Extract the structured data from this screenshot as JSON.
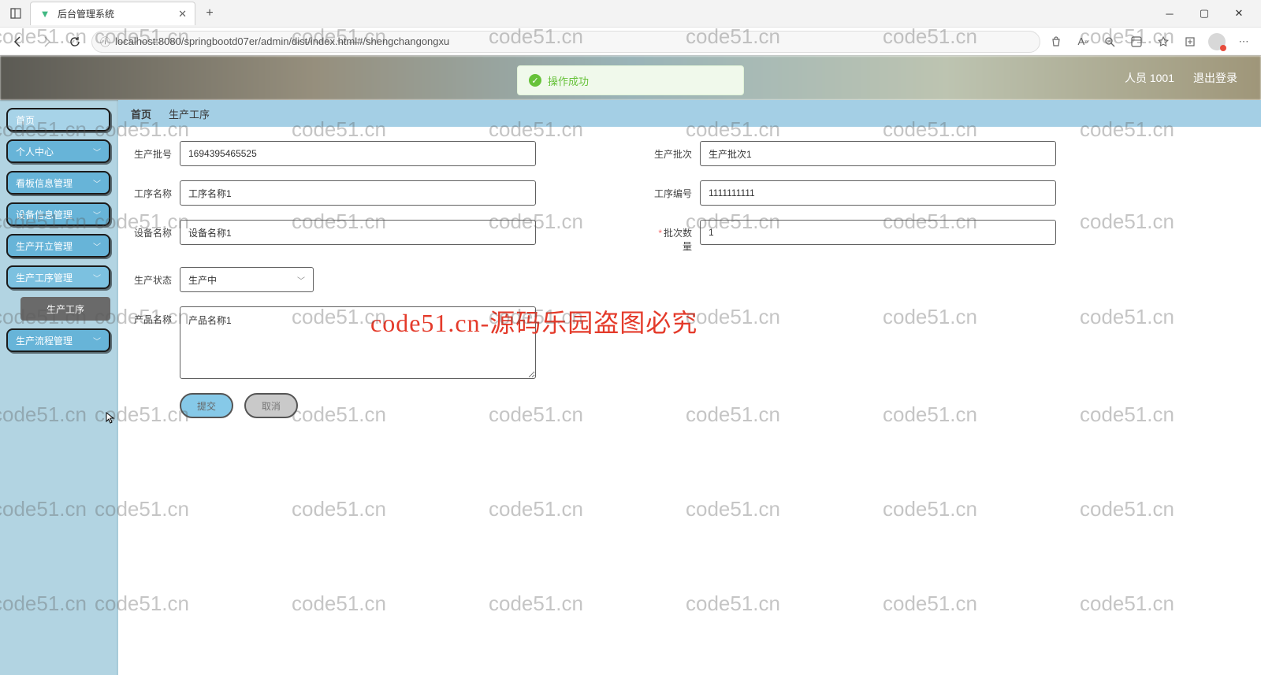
{
  "browser": {
    "tab_title": "后台管理系统",
    "url": "localhost:8080/springbootd07er/admin/dist/index.html#/shengchangongxu"
  },
  "toast": {
    "text": "操作成功"
  },
  "header": {
    "user": "人员 1001",
    "logout": "退出登录"
  },
  "sidebar": {
    "items": [
      {
        "label": "首页"
      },
      {
        "label": "个人中心"
      },
      {
        "label": "看板信息管理"
      },
      {
        "label": "设备信息管理"
      },
      {
        "label": "生产开立管理"
      },
      {
        "label": "生产工序管理"
      },
      {
        "label": "生产流程管理"
      }
    ],
    "sub_item": "生产工序"
  },
  "tabs": {
    "home": "首页",
    "current": "生产工序"
  },
  "form": {
    "f1_label": "生产批号",
    "f1_value": "1694395465525",
    "f2_label": "生产批次",
    "f2_value": "生产批次1",
    "f3_label": "工序名称",
    "f3_value": "工序名称1",
    "f4_label": "工序编号",
    "f4_value": "1111111111",
    "f5_label": "设备名称",
    "f5_value": "设备名称1",
    "f6_label": "批次数量",
    "f6_value": "1",
    "f7_label": "生产状态",
    "f7_value": "生产中",
    "f8_label": "产品名称",
    "f8_value": "产品名称1",
    "submit": "提交",
    "cancel": "取消"
  },
  "watermark": {
    "text": "code51.cn",
    "red": "code51.cn-源码乐园盗图必究"
  }
}
